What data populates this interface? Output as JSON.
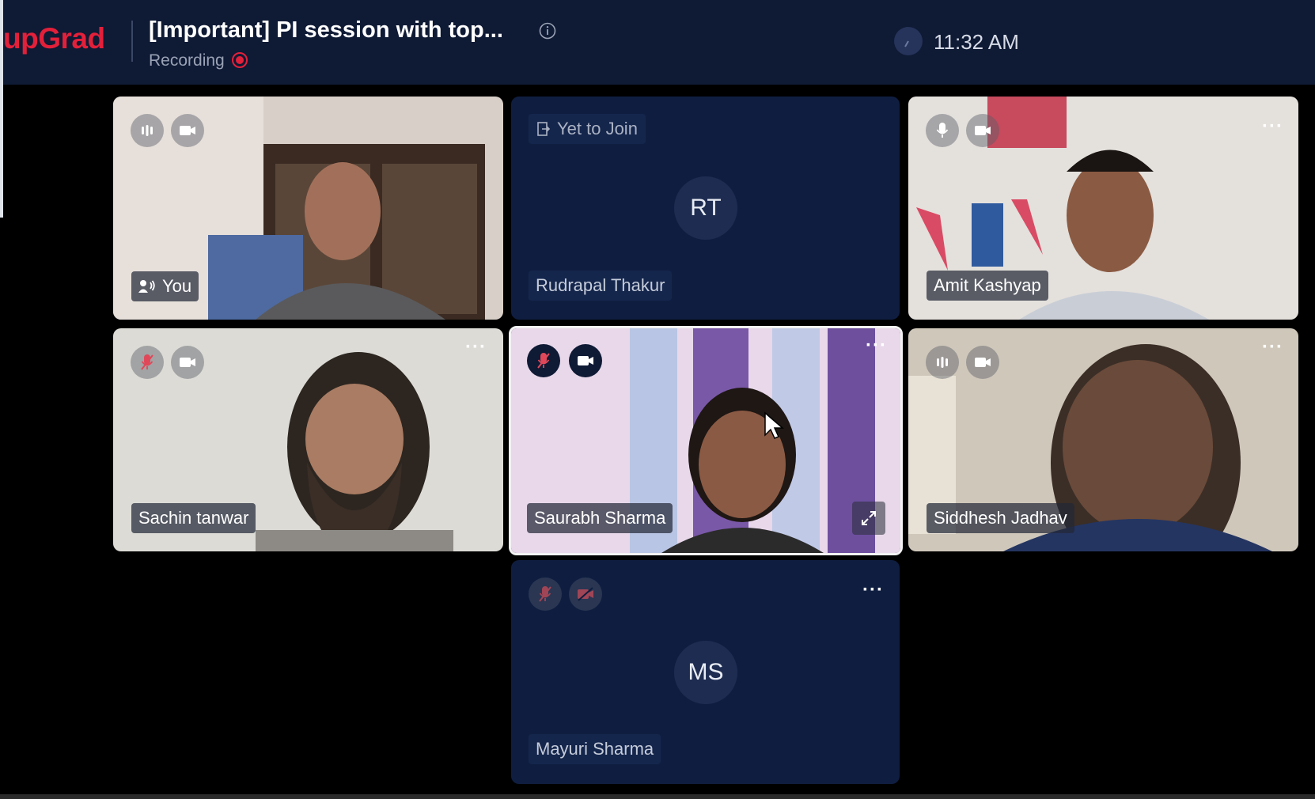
{
  "header": {
    "logo": "upGrad",
    "title": "[Important] PI session with top...",
    "status": "Recording",
    "time": "11:32 AM"
  },
  "colors": {
    "brand": "#e3203a",
    "topbar": "#0f1a35",
    "tile_blank": "#0f1e40",
    "recording": "#e3203a",
    "muted_red": "#e0485a"
  },
  "tiles": [
    {
      "name": "You",
      "mic": "speaking",
      "camera": "on",
      "has_video": true
    },
    {
      "name": "Rudrapal Thakur",
      "initials": "RT",
      "status": "Yet to Join",
      "has_video": false
    },
    {
      "name": "Amit Kashyap",
      "mic": "on",
      "camera": "on",
      "has_video": true
    },
    {
      "name": "Sachin tanwar",
      "mic": "muted",
      "camera": "on",
      "has_video": true
    },
    {
      "name": "Saurabh Sharma",
      "mic": "muted",
      "camera": "on",
      "has_video": true,
      "active": true
    },
    {
      "name": "Siddhesh Jadhav",
      "mic": "speaking",
      "camera": "on",
      "has_video": true
    },
    {
      "name": "Mayuri Sharma",
      "initials": "MS",
      "mic": "muted",
      "camera": "off",
      "has_video": false
    }
  ]
}
